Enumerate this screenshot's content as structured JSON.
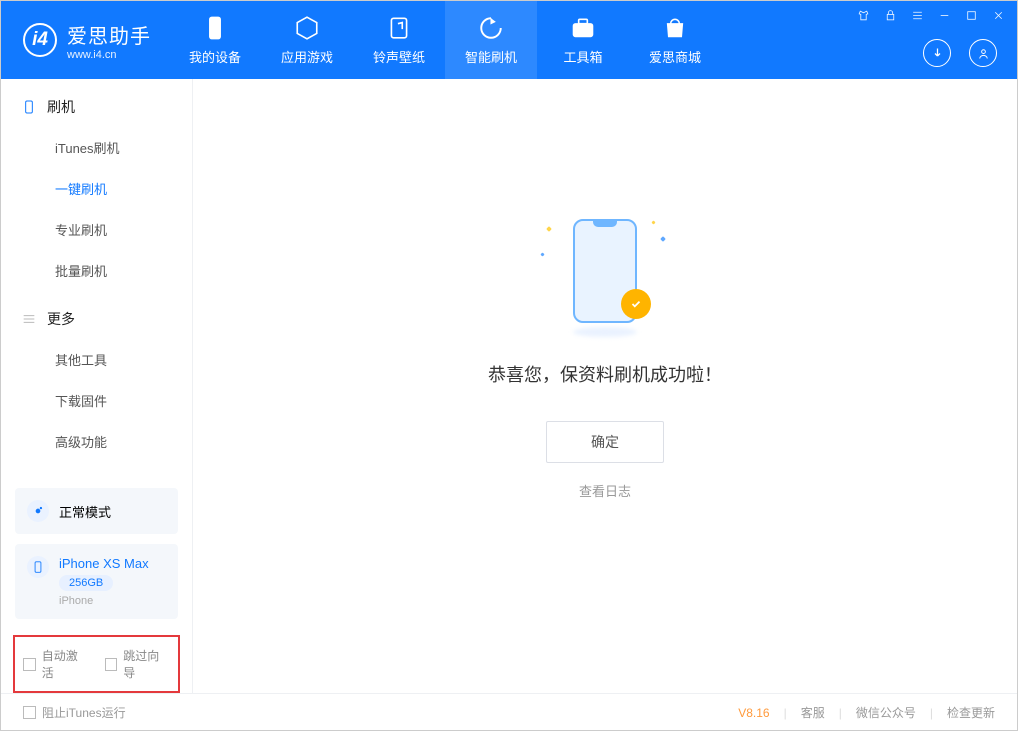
{
  "app": {
    "name": "爱思助手",
    "url": "www.i4.cn"
  },
  "nav": {
    "items": [
      {
        "label": "我的设备"
      },
      {
        "label": "应用游戏"
      },
      {
        "label": "铃声壁纸"
      },
      {
        "label": "智能刷机"
      },
      {
        "label": "工具箱"
      },
      {
        "label": "爱思商城"
      }
    ]
  },
  "sidebar": {
    "group1_title": "刷机",
    "group1_items": [
      "iTunes刷机",
      "一键刷机",
      "专业刷机",
      "批量刷机"
    ],
    "group2_title": "更多",
    "group2_items": [
      "其他工具",
      "下载固件",
      "高级功能"
    ]
  },
  "mode": {
    "label": "正常模式"
  },
  "device": {
    "name": "iPhone XS Max",
    "capacity": "256GB",
    "type": "iPhone"
  },
  "options": {
    "auto_activate": "自动激活",
    "skip_guide": "跳过向导"
  },
  "main": {
    "success_text": "恭喜您，保资料刷机成功啦！",
    "ok_label": "确定",
    "log_link": "查看日志"
  },
  "footer": {
    "block_itunes": "阻止iTunes运行",
    "version": "V8.16",
    "links": [
      "客服",
      "微信公众号",
      "检查更新"
    ]
  }
}
